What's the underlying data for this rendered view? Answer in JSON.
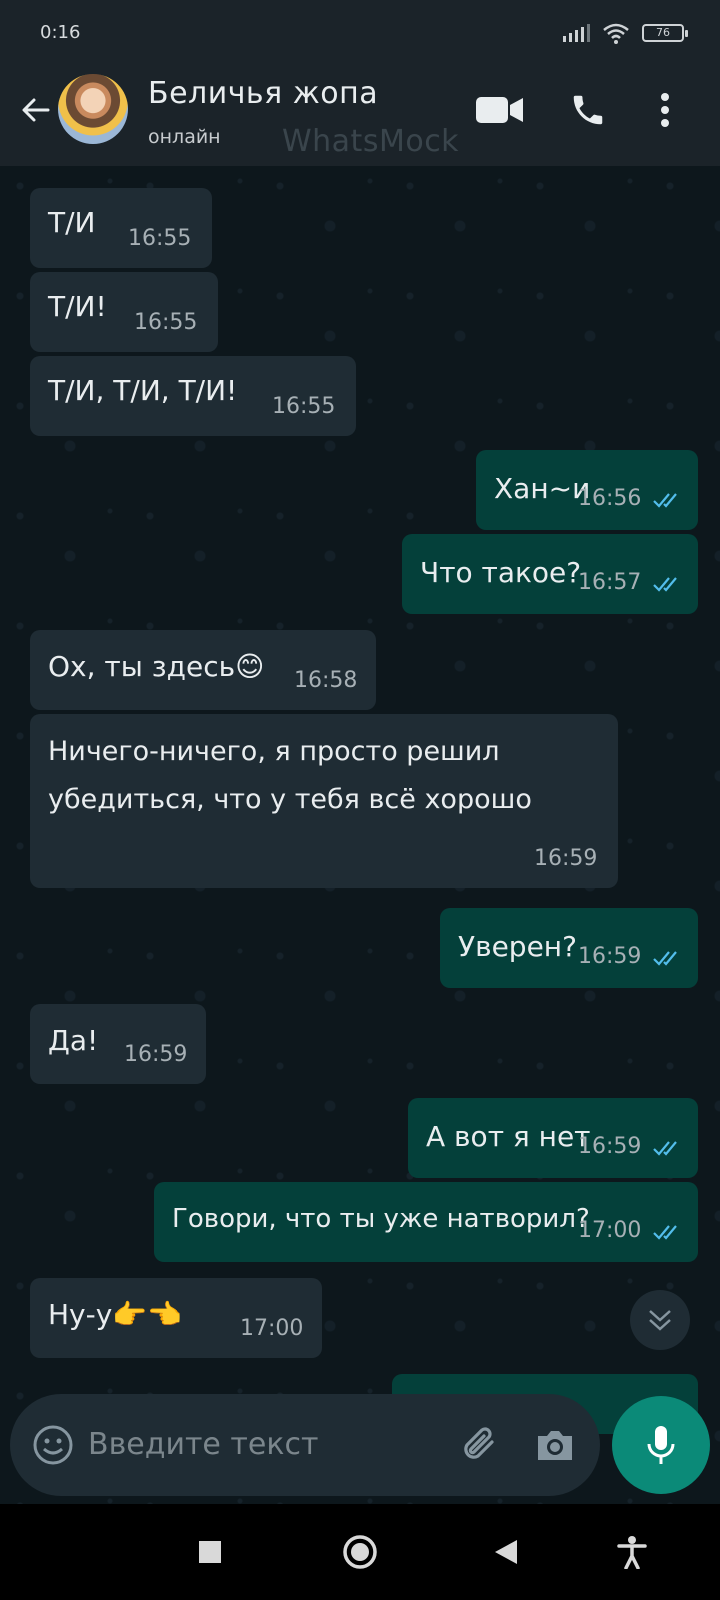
{
  "status_bar": {
    "time": "0:16",
    "battery": "76"
  },
  "header": {
    "contact_name": "Беличья жопа",
    "status": "онлайн",
    "watermark": "WhatsMock"
  },
  "messages": [
    {
      "dir": "in",
      "text": "Т/И",
      "time": "16:55"
    },
    {
      "dir": "in",
      "text": "Т/И!",
      "time": "16:55"
    },
    {
      "dir": "in",
      "text": "Т/И, Т/И, Т/И!",
      "time": "16:55"
    },
    {
      "dir": "out",
      "text": "Хан~и",
      "time": "16:56",
      "read": true
    },
    {
      "dir": "out",
      "text": "Что такое?",
      "time": "16:57",
      "read": true
    },
    {
      "dir": "in",
      "text": "Ох, ты здесь😊",
      "time": "16:58"
    },
    {
      "dir": "in",
      "text": "Ничего-ничего, я просто решил убедиться, что у тебя всё хорошо",
      "line1": "Ничего-ничего, я просто решил",
      "line2": "убедиться, что у тебя всё хорошо",
      "time": "16:59"
    },
    {
      "dir": "out",
      "text": "Уверен?",
      "time": "16:59",
      "read": true
    },
    {
      "dir": "in",
      "text": "Да!",
      "time": "16:59"
    },
    {
      "dir": "out",
      "text": "А вот я нет",
      "time": "16:59",
      "read": true
    },
    {
      "dir": "out",
      "text": "Говори, что ты уже натворил?",
      "time": "17:00",
      "read": true
    },
    {
      "dir": "in",
      "text": "Ну-у👉👈",
      "time": "17:00"
    }
  ],
  "input": {
    "placeholder": "Введите текст"
  },
  "icons": {
    "back": "arrow-left",
    "video": "video-camera",
    "call": "phone",
    "menu": "more-vertical",
    "emoji": "smiley",
    "attach": "paperclip",
    "camera": "camera",
    "mic": "microphone",
    "scroll": "chevron-double-down",
    "read_ticks": "double-check",
    "nav": [
      "square",
      "circle",
      "triangle-back",
      "accessibility"
    ]
  },
  "colors": {
    "header_bg": "#1b2329",
    "chat_bg": "#0d171c",
    "incoming_bubble": "#1f2c34",
    "outgoing_bubble": "#04403a",
    "accent": "#0b8a78",
    "read_tick": "#53bdeb"
  }
}
